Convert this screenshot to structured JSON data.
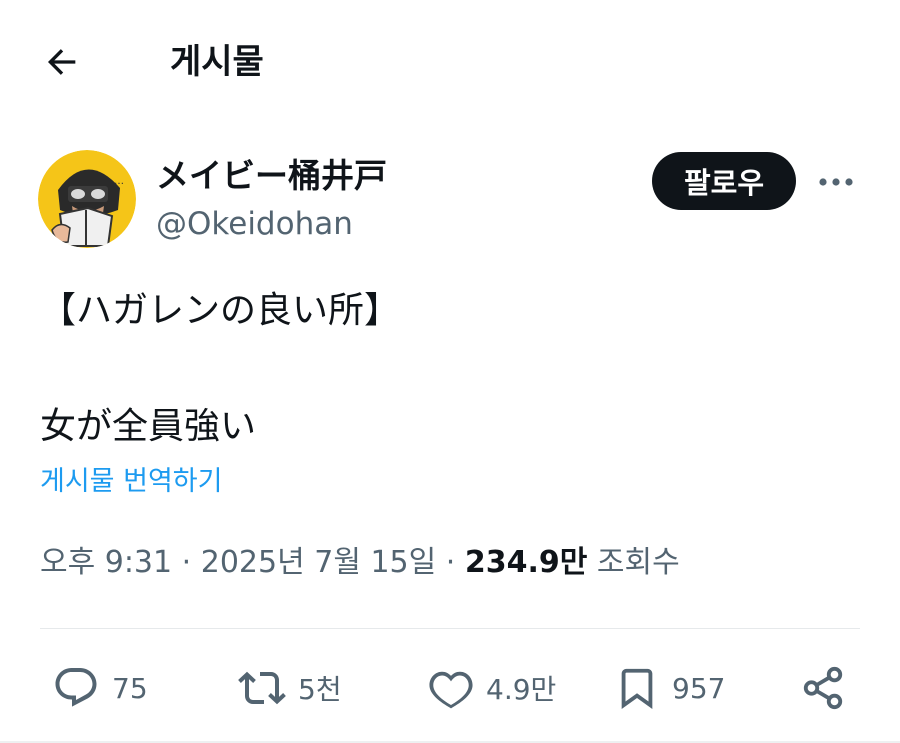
{
  "header": {
    "back_icon": "arrow-left-icon",
    "title": "게시물"
  },
  "author": {
    "display_name": "メイビー桶井戸",
    "handle": "@Okeidohan",
    "follow_label": "팔로우",
    "more_icon": "ellipsis-icon"
  },
  "tweet": {
    "text": "【ハガレンの良い所】\n\n女が全員強い",
    "translate_label": "게시물 번역하기"
  },
  "meta": {
    "time": "오후 9:31",
    "separator": "·",
    "date": "2025년 7월 15일",
    "views_count": "234.9만",
    "views_label": "조회수"
  },
  "actions": {
    "reply": {
      "icon": "reply-icon",
      "count": "75"
    },
    "retweet": {
      "icon": "retweet-icon",
      "count": "5천"
    },
    "like": {
      "icon": "heart-icon",
      "count": "4.9만"
    },
    "bookmark": {
      "icon": "bookmark-icon",
      "count": "957"
    },
    "share": {
      "icon": "share-icon"
    }
  },
  "colors": {
    "text": "#0f1419",
    "secondary": "#536471",
    "link": "#1d9bf0",
    "follow_bg": "#0f1419",
    "avatar_bg": "#f5c518"
  }
}
